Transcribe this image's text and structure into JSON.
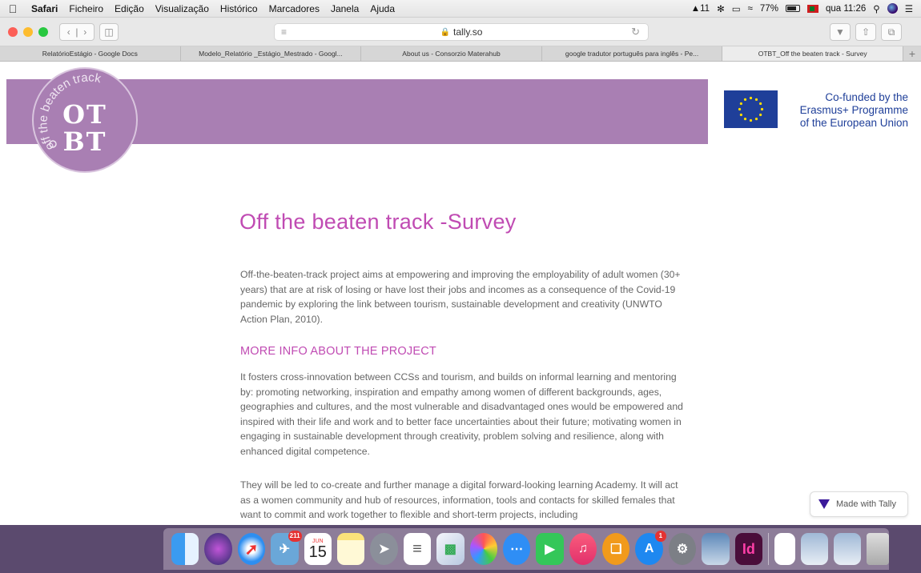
{
  "menubar": {
    "items": [
      "Safari",
      "Ficheiro",
      "Edição",
      "Visualização",
      "Histórico",
      "Marcadores",
      "Janela",
      "Ajuda"
    ],
    "status": {
      "input_source": "11",
      "battery": "77%",
      "clock": "qua 11:26"
    }
  },
  "toolbar": {
    "url": "tally.so"
  },
  "tabs": [
    "RelatórioEstágio - Google Docs",
    "Modelo_Relatório _Estágio_Mestrado - Googl...",
    "About us - Consorzio Materahub",
    "google tradutor português para inglês - Pe...",
    "OTBT_Off the beaten track - Survey"
  ],
  "page": {
    "logo": {
      "ring_text": "off the beaten track",
      "line1": "OT",
      "line2": "BT"
    },
    "eu_text": [
      "Co-funded by the",
      "Erasmus+ Programme",
      "of the European Union"
    ],
    "title": "Off the beaten track -Survey",
    "intro": "Off-the-beaten-track project aims at empowering and improving the employability of adult women (30+ years) that are at risk of losing or have lost their jobs and incomes as a consequence of the Covid-19 pandemic by exploring the link between tourism, sustainable development and creativity (UNWTO Action Plan, 2010).",
    "subhead": "MORE INFO ABOUT THE PROJECT",
    "para1": "It fosters cross-innovation between CCSs and tourism, and builds on informal learning and mentoring by: promoting networking, inspiration and empathy among women of different backgrounds, ages, geographies and cultures, and the most vulnerable and disadvantaged ones would be empowered and inspired with their life and work and to better face uncertainties about their future; motivating women in engaging in sustainable development through creativity, problem solving and resilience, along with enhanced digital competence.",
    "para2": "They will be led to co-create and further manage a digital forward-looking learning Academy. It will act as a women community and hub of resources, information, tools and contacts for skilled females that want to commit and work together to flexible and short-term projects, including",
    "made_with": "Made with Tally"
  },
  "dock": {
    "badges": {
      "photos": "211",
      "appstore": "1"
    },
    "calendar": {
      "month": "JUN",
      "day": "15"
    },
    "indesign_label": "Id"
  },
  "colors": {
    "brand": "#a97fb3",
    "accent": "#c04bb3",
    "eu_blue": "#1f3f99"
  }
}
